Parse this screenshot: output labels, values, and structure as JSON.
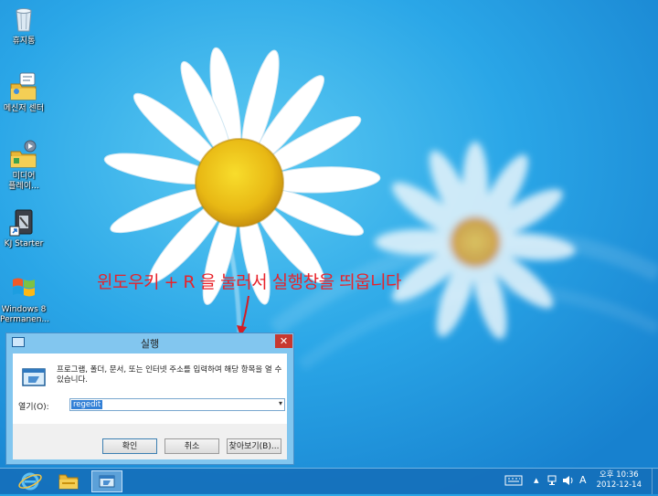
{
  "desktop_icons": [
    {
      "label": "휴지통",
      "icon": "recycle-bin-icon"
    },
    {
      "label": "메신저 센터",
      "icon": "messenger-folder-icon"
    },
    {
      "label": "미디어",
      "label2": "플레이...",
      "icon": "media-player-folder-icon"
    },
    {
      "label": "KJ Starter",
      "icon": "kj-starter-icon"
    },
    {
      "label": "Windows 8",
      "label2": "Permanen...",
      "icon": "windows-logo-icon"
    }
  ],
  "annotation": "윈도우키 + R 을 눌러서 실행창을 띄웁니다",
  "run_dialog": {
    "title": "실행",
    "close_label": "✕",
    "description": "프로그램, 폴더, 문서, 또는 인터넷 주소를 입력하여 해당 항목을 열 수 있습니다.",
    "open_label": "열기(O):",
    "open_value": "regedit",
    "ok_label": "확인",
    "cancel_label": "취소",
    "browse_label": "찾아보기(B)..."
  },
  "taskbar": {
    "clock_time": "오후 10:36",
    "clock_date": "2012-12-14",
    "ime_label": "A",
    "pinned": [
      "internet-explorer-icon",
      "file-explorer-icon",
      "run-dialog-icon"
    ]
  },
  "colors": {
    "sky": "#27a3e6",
    "annotation_red": "#e8222a",
    "close_red": "#c7382f",
    "dialog_frame": "#82c6ef",
    "selection_blue": "#3380d6"
  }
}
